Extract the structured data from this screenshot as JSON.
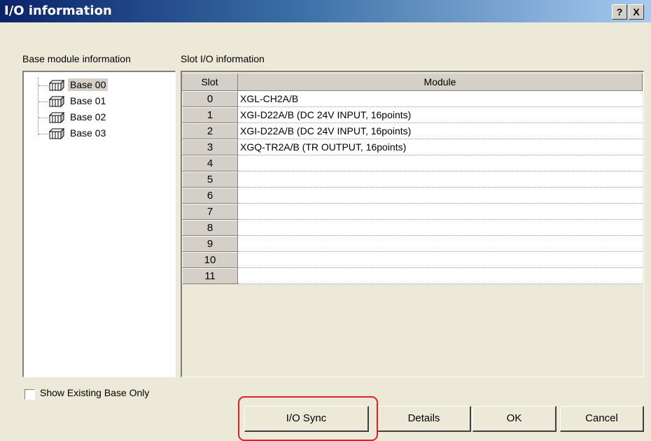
{
  "window": {
    "title": "I/O information",
    "help_button": "?",
    "close_button": "X"
  },
  "left_panel": {
    "label": "Base module information",
    "tree_items": [
      {
        "label": "Base 00",
        "selected": true
      },
      {
        "label": "Base 01",
        "selected": false
      },
      {
        "label": "Base 02",
        "selected": false
      },
      {
        "label": "Base 03",
        "selected": false
      }
    ],
    "show_existing_label": "Show Existing Base Only",
    "show_existing_checked": false
  },
  "right_panel": {
    "label": "Slot I/O information",
    "columns": [
      "Slot",
      "Module"
    ],
    "rows": [
      {
        "slot": "0",
        "module": "XGL-CH2A/B"
      },
      {
        "slot": "1",
        "module": "XGI-D22A/B (DC 24V INPUT, 16points)"
      },
      {
        "slot": "2",
        "module": "XGI-D22A/B (DC 24V INPUT, 16points)"
      },
      {
        "slot": "3",
        "module": "XGQ-TR2A/B (TR OUTPUT, 16points)"
      },
      {
        "slot": "4",
        "module": ""
      },
      {
        "slot": "5",
        "module": ""
      },
      {
        "slot": "6",
        "module": ""
      },
      {
        "slot": "7",
        "module": ""
      },
      {
        "slot": "8",
        "module": ""
      },
      {
        "slot": "9",
        "module": ""
      },
      {
        "slot": "10",
        "module": ""
      },
      {
        "slot": "11",
        "module": ""
      }
    ]
  },
  "buttons": {
    "io_sync": "I/O Sync",
    "details": "Details",
    "ok": "OK",
    "cancel": "Cancel"
  },
  "colors": {
    "title_bar_start": "#0a246a",
    "title_bar_end": "#a6caf0",
    "highlight": "#e02020",
    "dialog_bg": "#ece9d8"
  }
}
